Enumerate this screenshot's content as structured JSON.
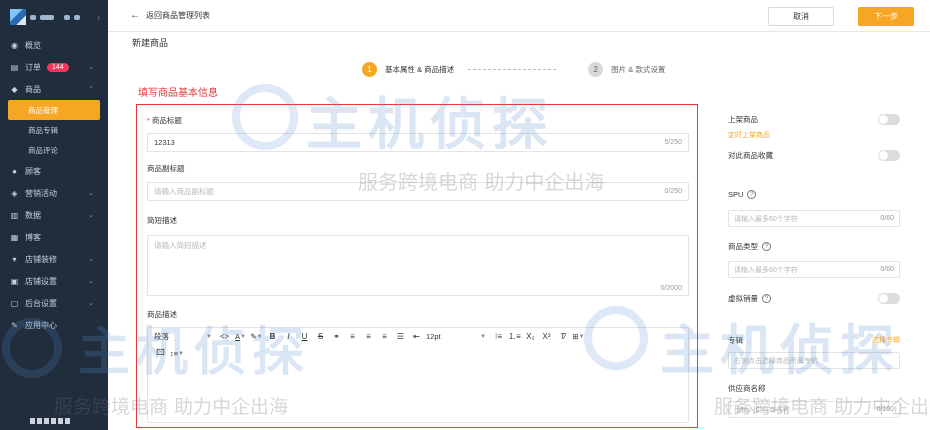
{
  "sidebar": {
    "items": [
      {
        "icon": "dashboard-icon",
        "label": "概览"
      },
      {
        "icon": "order-icon",
        "label": "订单",
        "badge": "144"
      },
      {
        "icon": "goods-icon",
        "label": "商品"
      },
      {
        "icon": "customer-icon",
        "label": "顾客"
      },
      {
        "icon": "marketing-icon",
        "label": "营销活动"
      },
      {
        "icon": "data-icon",
        "label": "数据"
      },
      {
        "icon": "blog-icon",
        "label": "博客"
      },
      {
        "icon": "store-decor-icon",
        "label": "店铺装修"
      },
      {
        "icon": "store-settings-icon",
        "label": "店铺设置"
      },
      {
        "icon": "admin-settings-icon",
        "label": "后台设置"
      },
      {
        "icon": "app-center-icon",
        "label": "应用中心"
      }
    ],
    "goods_sub": [
      "商品管理",
      "商品专辑",
      "商品评论"
    ]
  },
  "topbar": {
    "back_label": "返回商品管理列表",
    "cancel_label": "取消",
    "next_label": "下一步"
  },
  "page": {
    "title": "新建商品",
    "section_hint": "填写商品基本信息"
  },
  "steps": [
    {
      "num": "1",
      "label": "基本属性 & 商品描述"
    },
    {
      "num": "2",
      "label": "图片 & 款式设置"
    }
  ],
  "form": {
    "title_label": "商品标题",
    "title_value": "12313",
    "title_count": "5/250",
    "subtitle_label": "商品副标题",
    "subtitle_placeholder": "请输入商品副标题",
    "subtitle_count": "0/250",
    "brief_label": "简短描述",
    "brief_placeholder": "请输入简短描述",
    "brief_count": "0/2000",
    "desc_label": "商品描述",
    "toolbar": {
      "paragraph": "段落",
      "font_size": "12pt"
    }
  },
  "right_panel": {
    "on_shelf_label": "上架商品",
    "scheduled_link": "定时上架商品",
    "favorite_label": "对此商品收藏",
    "spu_label": "SPU",
    "spu_placeholder": "请输入最多60个字符",
    "spu_count": "0/60",
    "type_label": "商品类型",
    "type_placeholder": "请输入最多60个字符",
    "type_count": "0/60",
    "virtual_sales_label": "虚拟销量",
    "album_label": "专辑",
    "album_link": "选择专辑",
    "album_placeholder": "右侧点击选择商品所属专辑",
    "supplier_label": "供应商名称",
    "supplier_placeholder": "请输入供应商名称",
    "supplier_count": "0/100"
  },
  "watermark": {
    "brand": "主机侦探",
    "slogan": "服务跨境电商 助力中企出海"
  },
  "colors": {
    "accent": "#f5a623",
    "sidebar_bg": "#1f2d3d",
    "highlight_border": "#e53935",
    "badge": "#f5365c"
  }
}
